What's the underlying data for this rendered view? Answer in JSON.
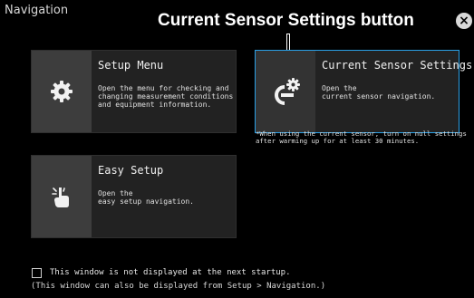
{
  "window": {
    "title": "Navigation"
  },
  "annotation": {
    "label": "Current Sensor Settings button"
  },
  "close_button": {
    "glyph": "×",
    "icon": "close-icon"
  },
  "cards": {
    "setup_menu": {
      "title": "Setup Menu",
      "description": "Open the menu for checking and\nchanging measurement conditions\nand equipment information.",
      "icon": "gear-icon"
    },
    "current_sensor": {
      "title": "Current Sensor Settings",
      "description": "Open the\ncurrent sensor navigation.",
      "icon": "current-sensor-gear-icon",
      "selected": true,
      "accent_color": "#2aa0e6"
    },
    "easy_setup": {
      "title": "Easy Setup",
      "description": "Open the\neasy setup navigation.",
      "icon": "pointing-hand-icon"
    }
  },
  "note": "*When using the current sensor, turn on null settings\n after warming up for at least 30 minutes.",
  "footer": {
    "checkbox_label": "This window is not displayed at the next startup.",
    "checked": false,
    "hint": "(This window can also be displayed from Setup > Navigation.)"
  }
}
